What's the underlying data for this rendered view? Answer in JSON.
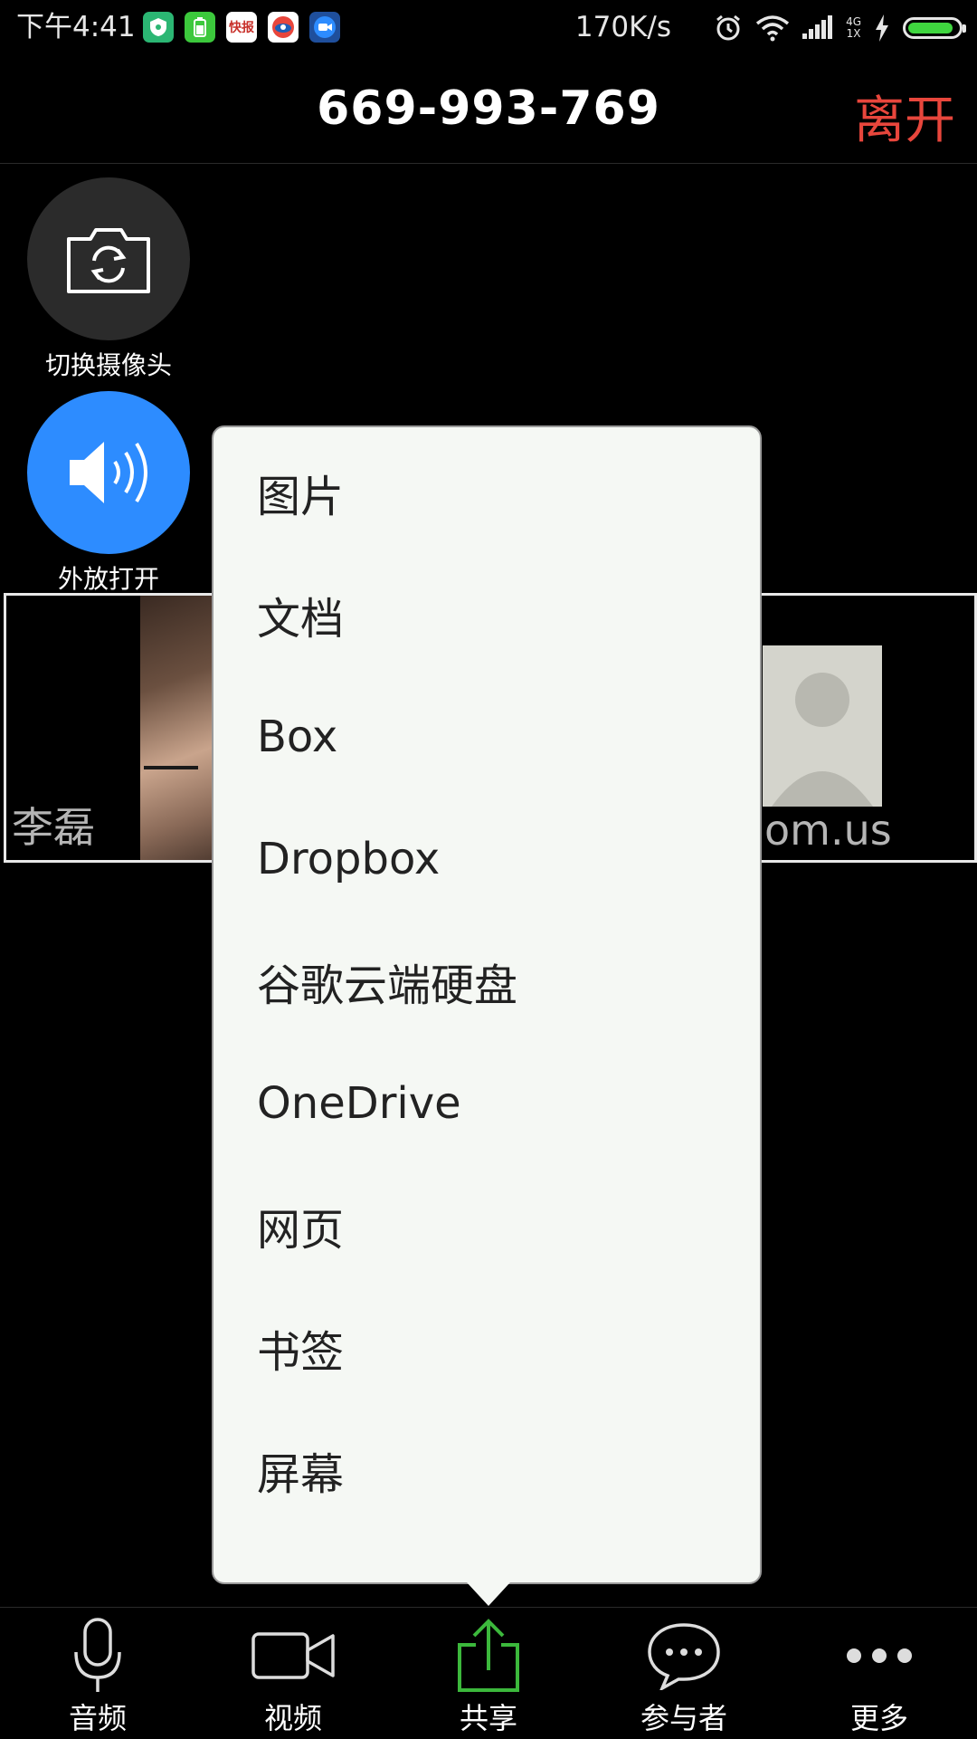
{
  "status_bar": {
    "time": "下午4:41",
    "apps": [
      {
        "name": "shield-app-icon",
        "color": "#2bb673",
        "glyph": "⬢"
      },
      {
        "name": "battery-app-icon",
        "color": "#3cc83c",
        "glyph": "▮"
      },
      {
        "name": "news-app-icon",
        "color": "#ffffff",
        "glyph": "快报"
      },
      {
        "name": "weibo-app-icon",
        "color": "#ffffff",
        "glyph": "◉"
      },
      {
        "name": "zoom-app-icon",
        "color": "#2d8cff",
        "glyph": "▶"
      }
    ],
    "net_speed": "170K/s",
    "network_top": "4G",
    "network_bottom": "1X",
    "battery_level": 0.92,
    "battery_color": "#3fd63f"
  },
  "header": {
    "meeting_id": "669-993-769",
    "leave_label": "离开",
    "leave_color": "#e8463c"
  },
  "controls": {
    "switch_camera": {
      "label": "切换摄像头",
      "icon": "camera-switch-icon",
      "color": "#2b2b2b"
    },
    "speaker": {
      "label": "外放打开",
      "icon": "speaker-icon",
      "color": "#2d8cff"
    }
  },
  "video": {
    "left_name": "李磊",
    "right_name": "om.us"
  },
  "share_menu": {
    "items": [
      {
        "label": "图片"
      },
      {
        "label": "文档"
      },
      {
        "label": "Box"
      },
      {
        "label": "Dropbox"
      },
      {
        "label": "谷歌云端硬盘"
      },
      {
        "label": "OneDrive"
      },
      {
        "label": "网页"
      },
      {
        "label": "书签"
      },
      {
        "label": "屏幕"
      }
    ]
  },
  "tabbar": {
    "active_color": "#3cb83c",
    "tabs": [
      {
        "label": "音频",
        "icon": "microphone-icon",
        "active": false
      },
      {
        "label": "视频",
        "icon": "video-camera-icon",
        "active": false
      },
      {
        "label": "共享",
        "icon": "share-upload-icon",
        "active": true
      },
      {
        "label": "参与者",
        "icon": "chat-bubble-icon",
        "active": false
      },
      {
        "label": "更多",
        "icon": "more-dots-icon",
        "active": false
      }
    ]
  }
}
